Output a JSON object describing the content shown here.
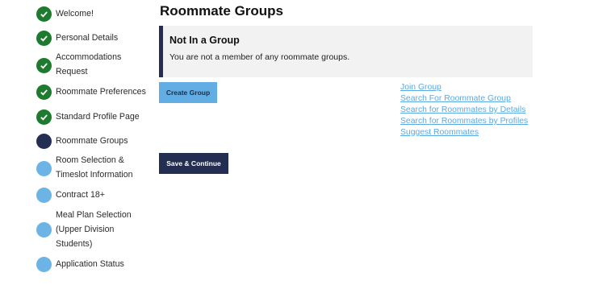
{
  "colors": {
    "complete": "#1e7a2e",
    "current": "#242e52",
    "pending": "#6cb3e6",
    "link": "#5aa9e2",
    "primary_button": "#62ade3",
    "dark_button": "#242e52"
  },
  "sidebar": {
    "steps": [
      {
        "label": "Welcome!",
        "status": "complete",
        "icon": "check-icon"
      },
      {
        "label": "Personal Details",
        "status": "complete",
        "icon": "check-icon"
      },
      {
        "label_lines": [
          "Accommodations",
          "Request"
        ],
        "status": "complete",
        "icon": "check-icon"
      },
      {
        "label": "Roommate Preferences",
        "status": "complete",
        "icon": "check-icon"
      },
      {
        "label": "Standard Profile Page",
        "status": "complete",
        "icon": "check-icon"
      },
      {
        "label": "Roommate Groups",
        "status": "current",
        "icon": "current-dot-icon"
      },
      {
        "label_lines": [
          "Room Selection &",
          "Timeslot Information"
        ],
        "status": "pending",
        "icon": "pending-dot-icon"
      },
      {
        "label": "Contract 18+",
        "status": "pending",
        "icon": "pending-dot-icon"
      },
      {
        "label_lines": [
          "Meal Plan Selection",
          "(Upper Division",
          "Students)"
        ],
        "status": "pending",
        "icon": "pending-dot-icon"
      },
      {
        "label": "Application Status",
        "status": "pending",
        "icon": "pending-dot-icon"
      }
    ]
  },
  "main": {
    "title": "Roommate Groups",
    "notice": {
      "title": "Not In a Group",
      "text": "You are not a member of any roommate groups."
    },
    "create_button": "Create Group",
    "save_button": "Save & Continue",
    "links": [
      "Join Group",
      "Search For Roommate Group",
      "Search for Roommates by Details",
      "Search for Roommates by Profiles",
      "Suggest Roommates"
    ]
  }
}
